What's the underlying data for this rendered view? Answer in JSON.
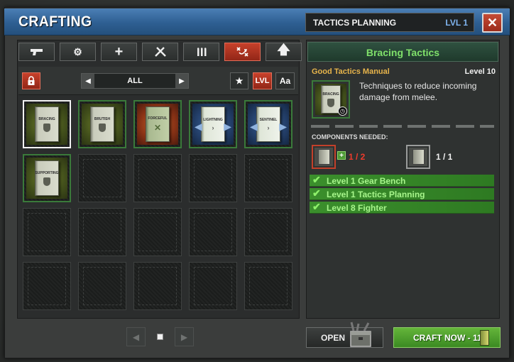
{
  "window": {
    "title": "CRAFTING"
  },
  "station": {
    "name": "TACTICS PLANNING",
    "level": "LVL 1"
  },
  "tabs": [
    {
      "icon": "pistol-icon",
      "active": false
    },
    {
      "icon": "gear-icon",
      "active": false
    },
    {
      "icon": "plus-icon",
      "active": false
    },
    {
      "icon": "crossed-tools-icon",
      "active": false
    },
    {
      "icon": "ammo-icon",
      "active": false
    },
    {
      "icon": "tactics-icon",
      "active": true
    },
    {
      "icon": "up-arrow-icon",
      "active": false
    }
  ],
  "filter": {
    "value": "ALL",
    "sort_level_label": "LVL",
    "sort_name_label": "Aa"
  },
  "items": [
    {
      "label": "BRACING",
      "theme": "green",
      "selected": true
    },
    {
      "label": "BRUTISH",
      "theme": "green",
      "selected": false
    },
    {
      "label": "FORCEFUL",
      "theme": "orange",
      "selected": false
    },
    {
      "label": "LIGHTNING",
      "theme": "blue",
      "selected": false
    },
    {
      "label": "SENTINEL",
      "theme": "blue",
      "selected": false
    },
    {
      "label": "SUPPORTING",
      "theme": "green",
      "selected": false
    }
  ],
  "detail": {
    "title": "Bracing Tactics",
    "subtitle": "Good Tactics Manual",
    "level": "Level 10",
    "book_label": "BRACING",
    "description": "Techniques to reduce incoming damage from melee.",
    "components_label": "COMPONENTS NEEDED:",
    "components": [
      {
        "count": "1 / 2"
      },
      {
        "count": "1 / 1"
      }
    ],
    "requirements": [
      "Level 1 Gear Bench",
      "Level 1 Tactics Planning",
      "Level 8 Fighter"
    ]
  },
  "buttons": {
    "open": "OPEN",
    "craft": "CRAFT NOW - 11"
  },
  "colors": {
    "accent_red": "#c7412b",
    "title_blue": "#2e5f92",
    "rarity_green": "#3a7a3a",
    "craft_green": "#4f9e2e"
  }
}
